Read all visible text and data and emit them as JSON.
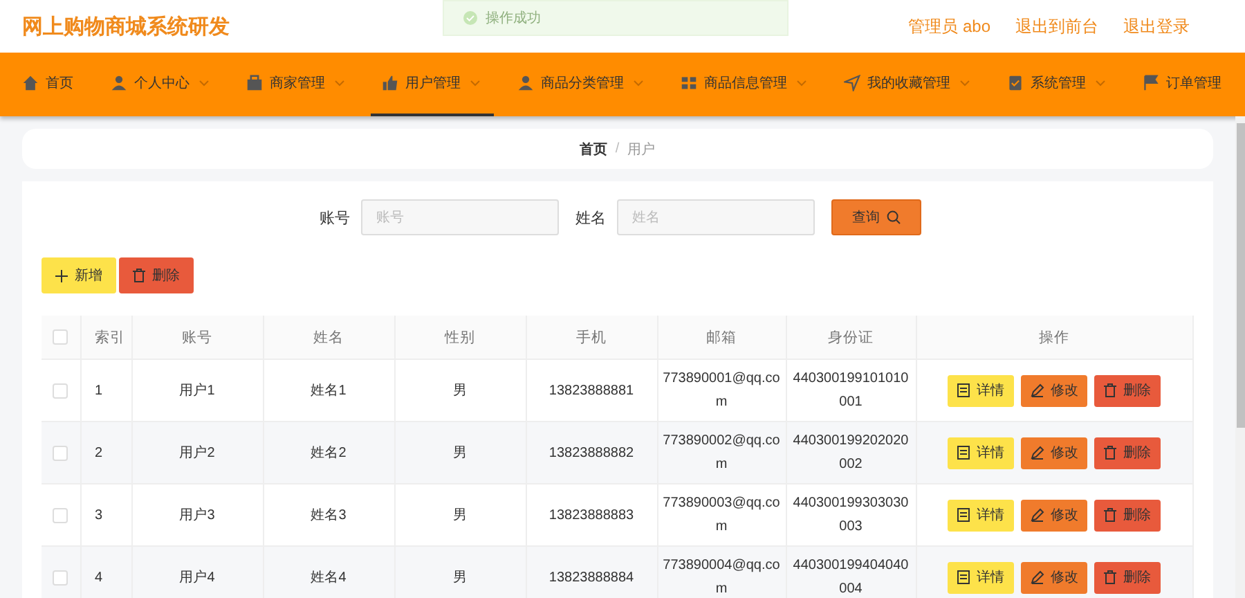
{
  "header": {
    "title": "网上购物商城系统研发",
    "links": [
      "管理员 abo",
      "退出到前台",
      "退出登录"
    ]
  },
  "toast": {
    "text": "操作成功"
  },
  "nav": [
    {
      "label": "首页",
      "selected": false,
      "dropdown": false
    },
    {
      "label": "个人中心",
      "selected": false,
      "dropdown": true
    },
    {
      "label": "商家管理",
      "selected": false,
      "dropdown": true
    },
    {
      "label": "用户管理",
      "selected": true,
      "dropdown": true
    },
    {
      "label": "商品分类管理",
      "selected": false,
      "dropdown": true
    },
    {
      "label": "商品信息管理",
      "selected": false,
      "dropdown": true
    },
    {
      "label": "我的收藏管理",
      "selected": false,
      "dropdown": true
    },
    {
      "label": "系统管理",
      "selected": false,
      "dropdown": true
    },
    {
      "label": "订单管理",
      "selected": false,
      "dropdown": false
    }
  ],
  "breadcrumb": {
    "separator": "/",
    "items": [
      {
        "label": "首页",
        "selected": false
      },
      {
        "label": "用户",
        "selected": true
      }
    ]
  },
  "search": {
    "fields": [
      {
        "label": "账号",
        "placeholder": "账号"
      },
      {
        "label": "姓名",
        "placeholder": "姓名"
      }
    ],
    "button": "查询"
  },
  "actions": [
    {
      "label": "新增",
      "kind": "add"
    },
    {
      "label": "删除",
      "kind": "delete"
    }
  ],
  "table": {
    "select_all_checked": false,
    "columns": [
      "索引",
      "账号",
      "姓名",
      "性别",
      "手机",
      "邮箱",
      "身份证",
      "操作"
    ],
    "rows": [
      {
        "checked": false,
        "cells": [
          "1",
          "用户1",
          "姓名1",
          "男",
          "13823888881",
          "773890001@qq.com",
          "440300199101010001"
        ],
        "actions": [
          {
            "label": "详情",
            "kind": "detail"
          },
          {
            "label": "修改",
            "kind": "edit"
          },
          {
            "label": "删除",
            "kind": "delete"
          }
        ]
      },
      {
        "checked": false,
        "cells": [
          "2",
          "用户2",
          "姓名2",
          "男",
          "13823888882",
          "773890002@qq.com",
          "440300199202020002"
        ],
        "actions": [
          {
            "label": "详情",
            "kind": "detail"
          },
          {
            "label": "修改",
            "kind": "edit"
          },
          {
            "label": "删除",
            "kind": "delete"
          }
        ]
      },
      {
        "checked": false,
        "cells": [
          "3",
          "用户3",
          "姓名3",
          "男",
          "13823888883",
          "773890003@qq.com",
          "440300199303030003"
        ],
        "actions": [
          {
            "label": "详情",
            "kind": "detail"
          },
          {
            "label": "修改",
            "kind": "edit"
          },
          {
            "label": "删除",
            "kind": "delete"
          }
        ]
      },
      {
        "checked": false,
        "cells": [
          "4",
          "用户4",
          "姓名4",
          "男",
          "13823888884",
          "773890004@qq.com",
          "440300199404040004"
        ],
        "actions": [
          {
            "label": "详情",
            "kind": "detail"
          },
          {
            "label": "修改",
            "kind": "edit"
          },
          {
            "label": "删除",
            "kind": "delete"
          }
        ]
      }
    ]
  }
}
